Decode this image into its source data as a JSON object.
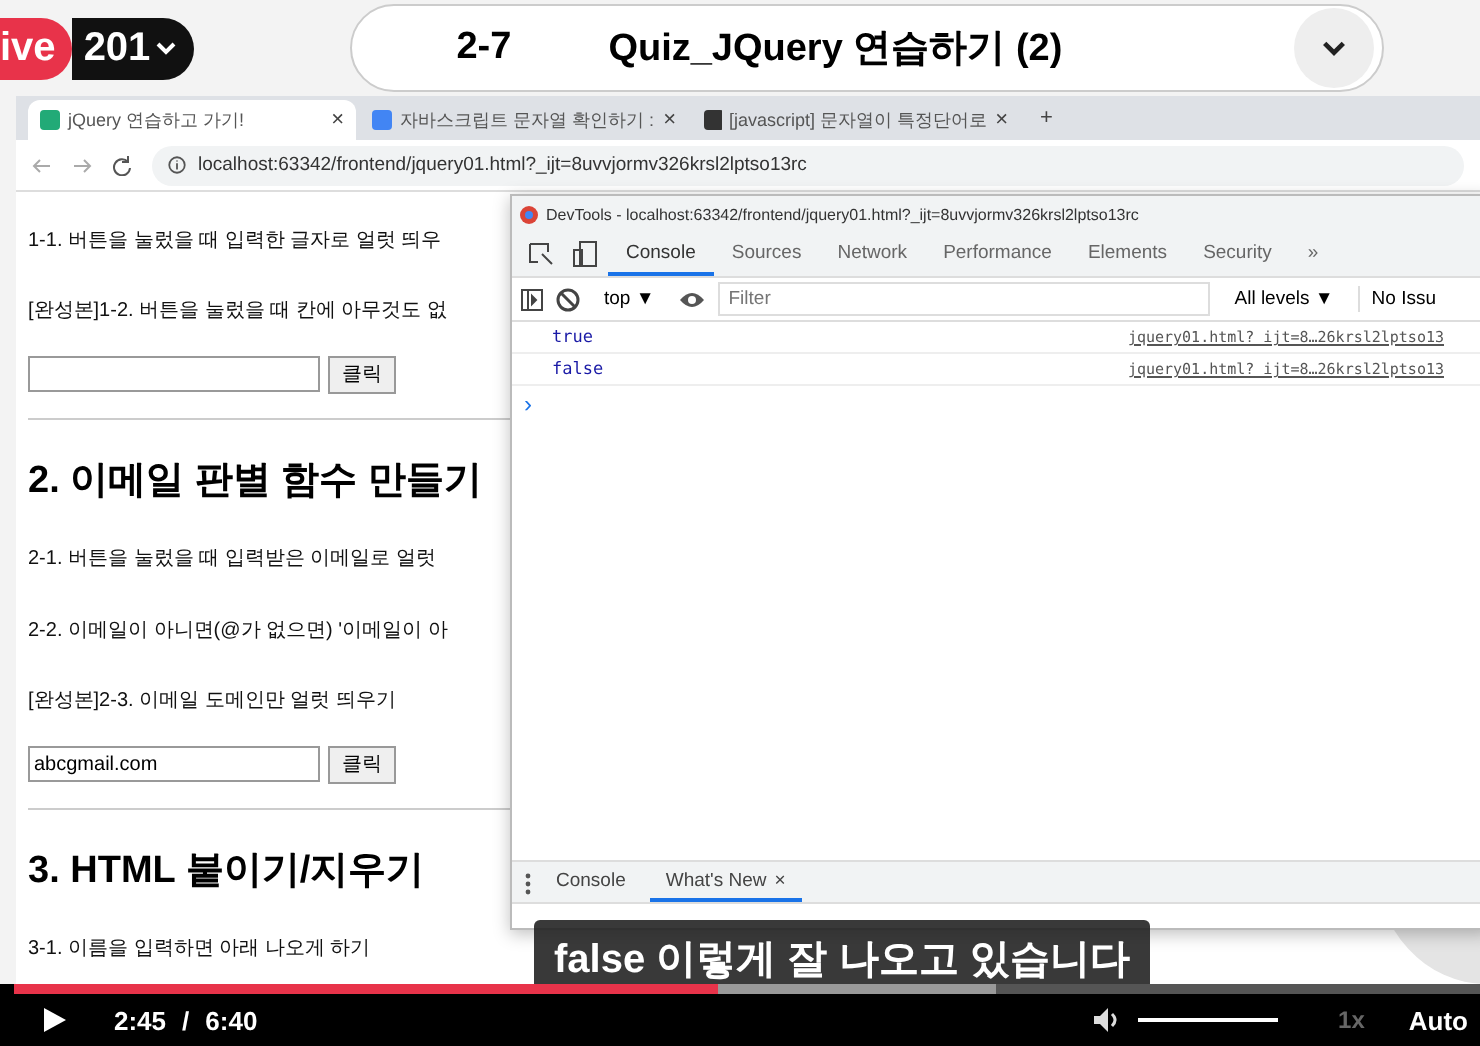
{
  "player": {
    "live_badge": "ive",
    "episode": "201",
    "lesson_number": "2-7",
    "lesson_title": "Quiz_JQuery 연습하기 (2)"
  },
  "browser": {
    "tabs": [
      {
        "title": "jQuery 연습하고 가기!",
        "selected": true,
        "close": "×"
      },
      {
        "title": "자바스크립트 문자열 확인하기 :",
        "selected": false,
        "close": "×"
      },
      {
        "title": "[javascript] 문자열이 특정단어로",
        "selected": false,
        "close": "×"
      }
    ],
    "new_tab": "+",
    "address": "localhost:63342/frontend/jquery01.html?_ijt=8uvvjormv326krsl2lptso13rc"
  },
  "page": {
    "blocks": [
      {
        "kind": "text",
        "text": "1-1. 버튼을 눌렀을 때 입력한 글자로 얼럿 띄우"
      },
      {
        "kind": "text",
        "text": "[완성본]1-2. 버튼을 눌렀을 때 칸에 아무것도 없"
      },
      {
        "kind": "form",
        "button": "클릭"
      },
      {
        "kind": "rule"
      },
      {
        "kind": "heading",
        "text": "2. 이메일 판별 함수 만들기"
      },
      {
        "kind": "text",
        "text": "2-1. 버튼을 눌렀을 때 입력받은 이메일로 얼럿"
      },
      {
        "kind": "text",
        "text": "2-2. 이메일이 아니면(@가 없으면) '이메일이 아"
      },
      {
        "kind": "text",
        "text": "[완성본]2-3. 이메일 도메인만 얼럿 띄우기"
      },
      {
        "kind": "form",
        "value": "abcgmail.com",
        "button": "클릭"
      },
      {
        "kind": "rule"
      },
      {
        "kind": "heading",
        "text": "3. HTML 붙이기/지우기"
      },
      {
        "kind": "text",
        "text": "3-1. 이름을 입력하면 아래 나오게 하기"
      }
    ]
  },
  "devtools": {
    "title": "DevTools - localhost:63342/frontend/jquery01.html?_ijt=8uvvjormv326krsl2lptso13rc",
    "tabs": [
      {
        "label": "Console",
        "selected": true
      },
      {
        "label": "Sources",
        "selected": false
      },
      {
        "label": "Network",
        "selected": false
      },
      {
        "label": "Performance",
        "selected": false
      },
      {
        "label": "Elements",
        "selected": false
      },
      {
        "label": "Security",
        "selected": false
      }
    ],
    "more_tabs": "»",
    "context": "top ▼",
    "filter_placeholder": "Filter",
    "levels": "All levels ▼",
    "issues": "No Issu",
    "console_rows": [
      {
        "value": "true",
        "source": "jquery01.html?_ijt=8…26krsl2lptso13"
      },
      {
        "value": "false",
        "source": "jquery01.html?_ijt=8…26krsl2lptso13"
      }
    ],
    "prompt": "›",
    "drawer_tabs": [
      {
        "label": "Console",
        "selected": false,
        "closable": false
      },
      {
        "label": "What's New",
        "selected": true,
        "closable": true
      }
    ],
    "drawer_close": "×"
  },
  "caption": "false 이렇게 잘 나오고 있습니다",
  "controls": {
    "progress": {
      "level": 0.48
    },
    "current_time": "2:45",
    "separator": "/",
    "duration": "6:40",
    "volume": {
      "level": 1
    },
    "speed": "1x",
    "quality": "Auto"
  }
}
